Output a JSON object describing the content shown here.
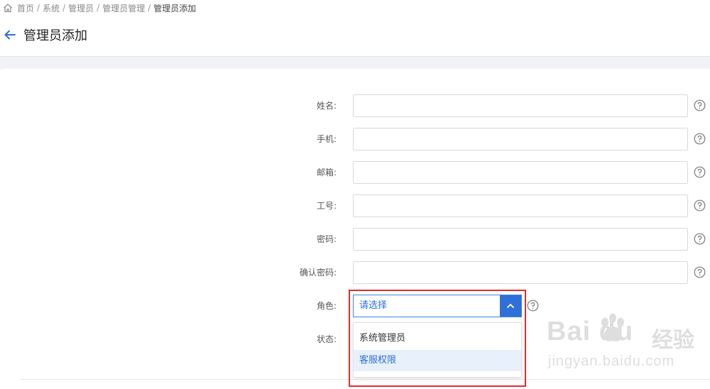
{
  "breadcrumb": {
    "items": [
      "首页",
      "系统",
      "管理员",
      "管理员管理",
      "管理员添加"
    ],
    "separator": "/"
  },
  "header": {
    "title": "管理员添加"
  },
  "form": {
    "fields": [
      {
        "label": "姓名:",
        "value": "",
        "placeholder": ""
      },
      {
        "label": "手机:",
        "value": "",
        "placeholder": ""
      },
      {
        "label": "邮箱:",
        "value": "",
        "placeholder": ""
      },
      {
        "label": "工号:",
        "value": "",
        "placeholder": ""
      },
      {
        "label": "密码:",
        "value": "",
        "placeholder": ""
      },
      {
        "label": "确认密码:",
        "value": "",
        "placeholder": ""
      }
    ],
    "role": {
      "label": "角色:",
      "selected": "请选择",
      "options": [
        "系统管理员",
        "客服权限"
      ],
      "highlighted_option": "客服权限"
    },
    "status": {
      "label": "状态:"
    }
  },
  "watermark": {
    "brand": "Bai du",
    "brand2": "经验",
    "url": "jingyan.baidu.com"
  },
  "colors": {
    "accent": "#2e6fd8",
    "highlight_border": "#e22c2c",
    "page_band": "#f0f2f5",
    "option_hover": "#e8f0fb"
  },
  "icons": [
    "home-icon",
    "back-arrow-icon",
    "help-icon",
    "chevron-up-icon",
    "paw-icon"
  ]
}
